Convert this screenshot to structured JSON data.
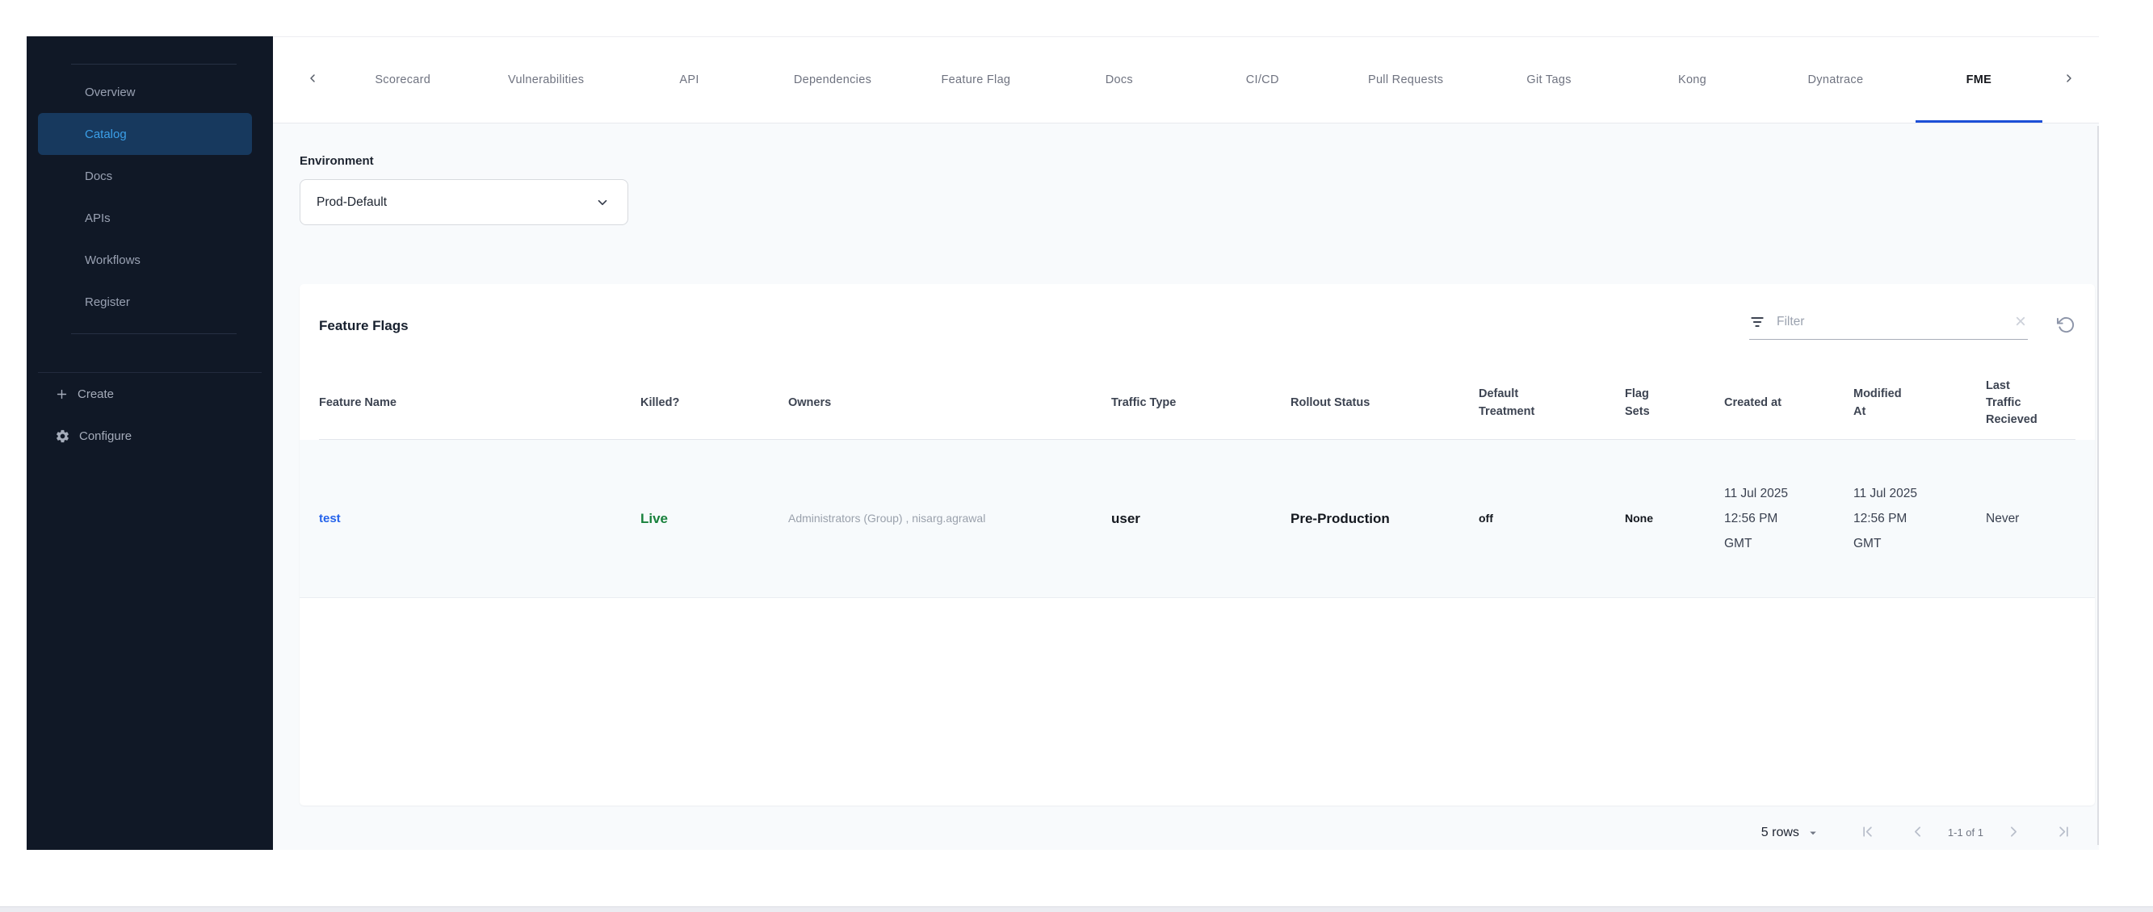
{
  "sidebar": {
    "items": [
      {
        "label": "Overview",
        "active": false
      },
      {
        "label": "Catalog",
        "active": true
      },
      {
        "label": "Docs",
        "active": false
      },
      {
        "label": "APIs",
        "active": false
      },
      {
        "label": "Workflows",
        "active": false
      },
      {
        "label": "Register",
        "active": false
      }
    ],
    "create_label": "Create",
    "configure_label": "Configure"
  },
  "tabs": {
    "items": [
      "Scorecard",
      "Vulnerabilities",
      "API",
      "Dependencies",
      "Feature Flag",
      "Docs",
      "CI/CD",
      "Pull Requests",
      "Git Tags",
      "Kong",
      "Dynatrace",
      "FME"
    ],
    "active": "FME"
  },
  "environment": {
    "label": "Environment",
    "selected": "Prod-Default"
  },
  "feature_flags": {
    "title": "Feature Flags",
    "filter_placeholder": "Filter",
    "columns": [
      "Feature Name",
      "Killed?",
      "Owners",
      "Traffic Type",
      "Rollout Status",
      "Default Treatment",
      "Flag Sets",
      "Created at",
      "Modified At",
      "Last Traffic Recieved"
    ],
    "rows": [
      {
        "feature_name": "test",
        "killed": "Live",
        "owners": "Administrators (Group) , nisarg.agrawal",
        "traffic_type": "user",
        "rollout_status": "Pre-Production",
        "default_treatment": "off",
        "flag_sets": "None",
        "created_at": "11 Jul 2025 12:56 PM GMT",
        "modified_at": "11 Jul 2025 12:56 PM GMT",
        "last_traffic_recieved": "Never"
      }
    ]
  },
  "pagination": {
    "rows_per_page": "5 rows",
    "range": "1-1 of 1"
  },
  "colors": {
    "sidebar_bg": "#101826",
    "sidebar_active_bg": "#17395E",
    "sidebar_active_text": "#3B9FE8",
    "tab_active_underline": "#1D4FD7",
    "link_blue": "#2563EB",
    "live_green": "#18813C",
    "page_bg": "#F8FAFC",
    "card_bg": "#FFFFFF"
  }
}
